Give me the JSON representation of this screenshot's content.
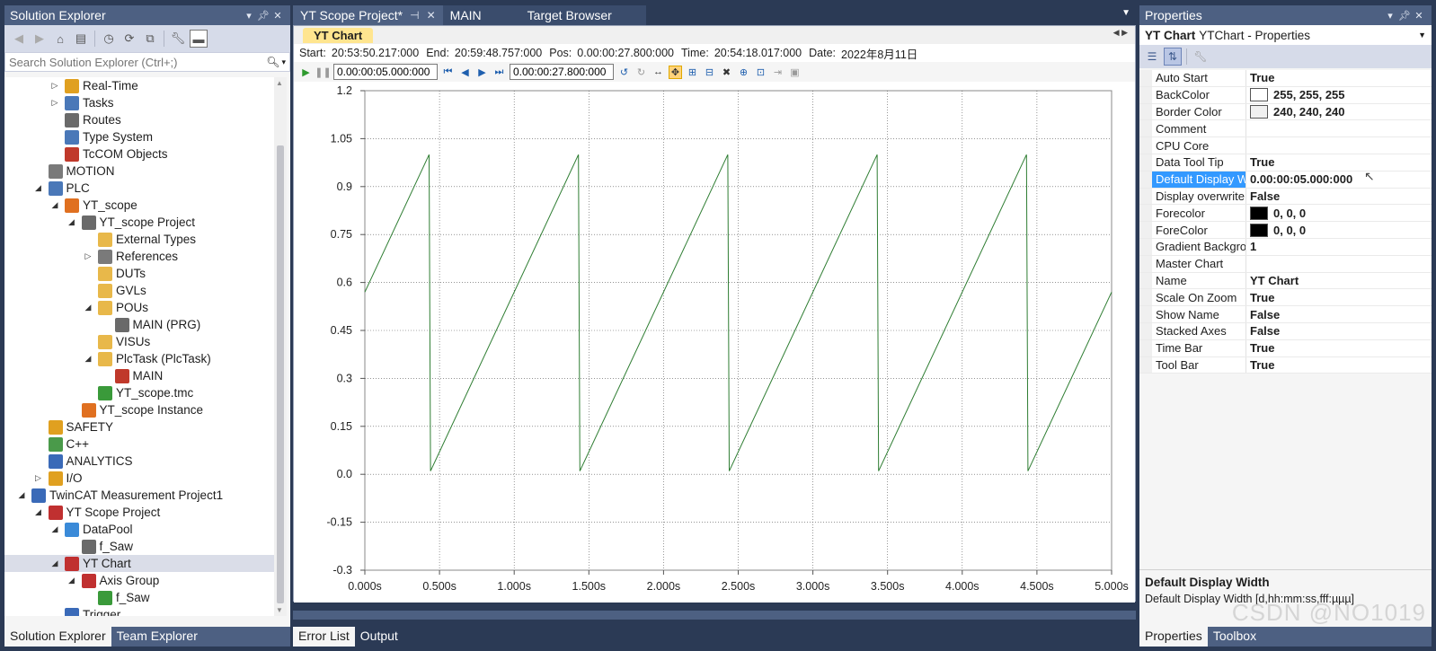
{
  "solution_explorer": {
    "title": "Solution Explorer",
    "search_placeholder": "Search Solution Explorer (Ctrl+;)",
    "tree": [
      {
        "label": "Real-Time",
        "depth": 2,
        "expander": "collapsed",
        "icon": "realtime-icon",
        "color": "#e0a020"
      },
      {
        "label": "Tasks",
        "depth": 2,
        "expander": "collapsed",
        "icon": "tasks-icon",
        "color": "#4a78b8"
      },
      {
        "label": "Routes",
        "depth": 2,
        "expander": "none",
        "icon": "routes-icon",
        "color": "#6a6a6a"
      },
      {
        "label": "Type System",
        "depth": 2,
        "expander": "none",
        "icon": "type-system-icon",
        "color": "#4a78b8"
      },
      {
        "label": "TcCOM Objects",
        "depth": 2,
        "expander": "none",
        "icon": "tccom-icon",
        "color": "#c0392b"
      },
      {
        "label": "MOTION",
        "depth": 1,
        "expander": "none",
        "icon": "motion-icon",
        "color": "#7a7a7a"
      },
      {
        "label": "PLC",
        "depth": 1,
        "expander": "expanded",
        "icon": "plc-icon",
        "color": "#4a78b8"
      },
      {
        "label": "YT_scope",
        "depth": 2,
        "expander": "expanded",
        "icon": "plc-project-icon",
        "color": "#e07020"
      },
      {
        "label": "YT_scope Project",
        "depth": 3,
        "expander": "expanded",
        "icon": "project-icon",
        "color": "#6a6a6a"
      },
      {
        "label": "External Types",
        "depth": 4,
        "expander": "none",
        "icon": "folder-icon",
        "color": "#e8b84a"
      },
      {
        "label": "References",
        "depth": 4,
        "expander": "collapsed",
        "icon": "references-icon",
        "color": "#7a7a7a"
      },
      {
        "label": "DUTs",
        "depth": 4,
        "expander": "none",
        "icon": "folder-icon",
        "color": "#e8b84a"
      },
      {
        "label": "GVLs",
        "depth": 4,
        "expander": "none",
        "icon": "folder-icon",
        "color": "#e8b84a"
      },
      {
        "label": "POUs",
        "depth": 4,
        "expander": "expanded",
        "icon": "folder-open-icon",
        "color": "#e8b84a"
      },
      {
        "label": "MAIN (PRG)",
        "depth": 5,
        "expander": "none",
        "icon": "program-icon",
        "color": "#6a6a6a"
      },
      {
        "label": "VISUs",
        "depth": 4,
        "expander": "none",
        "icon": "folder-icon",
        "color": "#e8b84a"
      },
      {
        "label": "PlcTask (PlcTask)",
        "depth": 4,
        "expander": "expanded",
        "icon": "task-icon",
        "color": "#e8b84a"
      },
      {
        "label": "MAIN",
        "depth": 5,
        "expander": "none",
        "icon": "program-call-icon",
        "color": "#c0392b"
      },
      {
        "label": "YT_scope.tmc",
        "depth": 4,
        "expander": "none",
        "icon": "tmc-icon",
        "color": "#3a9a3a"
      },
      {
        "label": "YT_scope Instance",
        "depth": 3,
        "expander": "none",
        "icon": "instance-icon",
        "color": "#e07020"
      },
      {
        "label": "SAFETY",
        "depth": 1,
        "expander": "none",
        "icon": "safety-icon",
        "color": "#e0a020"
      },
      {
        "label": "C++",
        "depth": 1,
        "expander": "none",
        "icon": "cpp-icon",
        "color": "#4a9a4a"
      },
      {
        "label": "ANALYTICS",
        "depth": 1,
        "expander": "none",
        "icon": "analytics-icon",
        "color": "#3a6ab8"
      },
      {
        "label": "I/O",
        "depth": 1,
        "expander": "collapsed",
        "icon": "io-icon",
        "color": "#e0a020"
      },
      {
        "label": "TwinCAT Measurement Project1",
        "depth": 0,
        "expander": "expanded",
        "icon": "measurement-project-icon",
        "color": "#3a6ab8"
      },
      {
        "label": "YT Scope Project",
        "depth": 1,
        "expander": "expanded",
        "icon": "scope-project-icon",
        "color": "#c03030"
      },
      {
        "label": "DataPool",
        "depth": 2,
        "expander": "expanded",
        "icon": "datapool-icon",
        "color": "#3a8ad8"
      },
      {
        "label": "f_Saw",
        "depth": 3,
        "expander": "none",
        "icon": "channel-icon",
        "color": "#6a6a6a"
      },
      {
        "label": "YT Chart",
        "depth": 2,
        "expander": "expanded",
        "icon": "chart-icon",
        "color": "#c03030",
        "selected": true
      },
      {
        "label": "Axis Group",
        "depth": 3,
        "expander": "expanded",
        "icon": "axis-group-icon",
        "color": "#c03030"
      },
      {
        "label": "f_Saw",
        "depth": 4,
        "expander": "none",
        "icon": "channel-green-icon",
        "color": "#3a9a3a"
      },
      {
        "label": "Trigger",
        "depth": 2,
        "expander": "none",
        "icon": "trigger-icon",
        "color": "#3a6ab8"
      }
    ],
    "bottom_tabs": [
      "Solution Explorer",
      "Team Explorer"
    ]
  },
  "document_tabs": [
    {
      "label": "YT Scope Project*",
      "active": true
    },
    {
      "label": "MAIN",
      "active": false
    },
    {
      "label": "Target Browser",
      "active": false
    }
  ],
  "scope": {
    "chart_tab": "YT Chart",
    "info": {
      "start_label": "Start:",
      "start": "20:53:50.217:000",
      "end_label": "End:",
      "end": "20:59:48.757:000",
      "pos_label": "Pos:",
      "pos": "0.00:00:27.800:000",
      "time_label": "Time:",
      "time": "20:54:18.017:000",
      "date_label": "Date:",
      "date": "2022年8月11日"
    },
    "display_width_value": "0.00:00:05.000:000",
    "position_value": "0.00:00:27.800:000"
  },
  "chart_data": {
    "type": "line",
    "title": "",
    "xlabel": "",
    "ylabel": "",
    "x_ticks": [
      "0.000s",
      "0.500s",
      "1.000s",
      "1.500s",
      "2.000s",
      "2.500s",
      "3.000s",
      "3.500s",
      "4.000s",
      "4.500s",
      "5.000s"
    ],
    "y_ticks": [
      "1.2",
      "1.05",
      "0.9",
      "0.75",
      "0.6",
      "0.45",
      "0.3",
      "0.15",
      "0.0",
      "-0.15",
      "-0.3"
    ],
    "xlim": [
      0,
      5
    ],
    "ylim": [
      -0.3,
      1.2
    ],
    "grid": true,
    "series": [
      {
        "color": "#2e7d32",
        "x": [
          0,
          0.43,
          0.44,
          1.43,
          1.44,
          2.43,
          2.44,
          3.43,
          3.44,
          4.43,
          4.44,
          5.0
        ],
        "y": [
          0.57,
          1.0,
          0.01,
          1.0,
          0.01,
          1.0,
          0.01,
          1.0,
          0.01,
          1.0,
          0.01,
          0.57
        ]
      }
    ]
  },
  "error_strip": {
    "tabs": [
      "Error List",
      "Output"
    ]
  },
  "properties": {
    "title": "Properties",
    "object_name": "YT Chart",
    "object_type": "YTChart - Properties",
    "rows": [
      {
        "name": "Auto Start",
        "value": "True"
      },
      {
        "name": "BackColor",
        "value": "255, 255, 255",
        "swatch": "#ffffff"
      },
      {
        "name": "Border Color",
        "value": "240, 240, 240",
        "swatch": "#f0f0f0"
      },
      {
        "name": "Comment",
        "value": ""
      },
      {
        "name": "CPU Core",
        "value": ""
      },
      {
        "name": "Data Tool Tip",
        "value": "True"
      },
      {
        "name": "Default Display W",
        "value": "0.00:00:05.000:000",
        "selected": true
      },
      {
        "name": "Display overwrite",
        "value": "False"
      },
      {
        "name": "Forecolor",
        "value": "0, 0, 0",
        "swatch": "#000000"
      },
      {
        "name": "ForeColor",
        "value": "0, 0, 0",
        "swatch": "#000000"
      },
      {
        "name": "Gradient Backgro",
        "value": "1"
      },
      {
        "name": "Master Chart",
        "value": ""
      },
      {
        "name": "Name",
        "value": "YT Chart"
      },
      {
        "name": "Scale On Zoom",
        "value": "True"
      },
      {
        "name": "Show Name",
        "value": "False"
      },
      {
        "name": "Stacked Axes",
        "value": "False"
      },
      {
        "name": "Time Bar",
        "value": "True"
      },
      {
        "name": "Tool Bar",
        "value": "True"
      }
    ],
    "description_title": "Default Display Width",
    "description_text": "Default Display Width [d,hh:mm:ss,fff:µµµ]",
    "bottom_tabs": [
      "Properties",
      "Toolbox"
    ]
  },
  "watermark": "CSDN @NO1019"
}
